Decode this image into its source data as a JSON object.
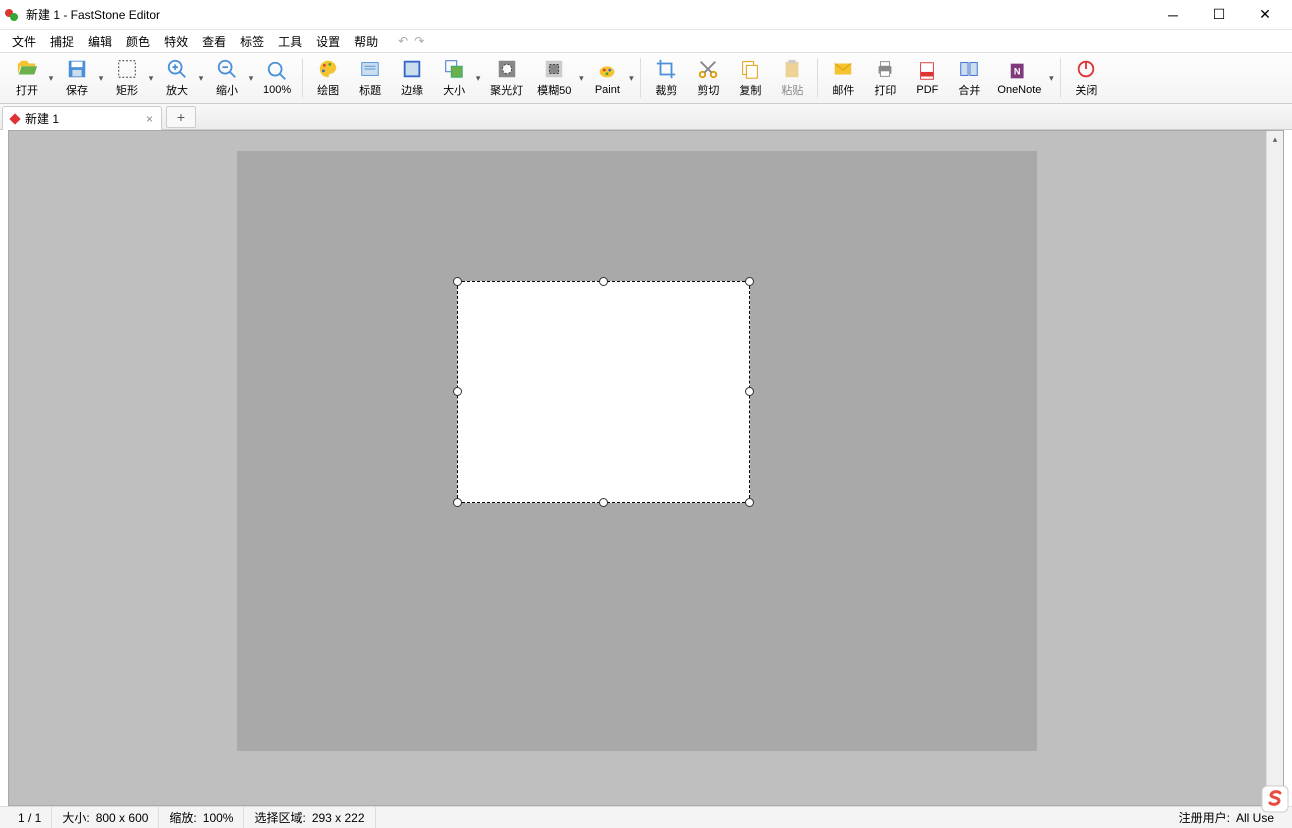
{
  "title": "新建 1 - FastStone Editor",
  "menu": [
    "文件",
    "捕捉",
    "编辑",
    "颜色",
    "特效",
    "查看",
    "标签",
    "工具",
    "设置",
    "帮助"
  ],
  "toolbar": {
    "open": "打开",
    "save": "保存",
    "rect": "矩形",
    "zoomin": "放大",
    "zoomout": "缩小",
    "zoom100": "100%",
    "draw": "绘图",
    "caption": "标题",
    "edge": "边缘",
    "size": "大小",
    "spotlight": "聚光灯",
    "blur": "模糊50",
    "paint": "Paint",
    "crop": "裁剪",
    "cut": "剪切",
    "copy": "复制",
    "paste": "粘贴",
    "mail": "邮件",
    "print": "打印",
    "pdf": "PDF",
    "merge": "合并",
    "onenote": "OneNote",
    "close": "关闭"
  },
  "tab": {
    "name": "新建 1"
  },
  "status": {
    "page": "1 / 1",
    "size_label": "大小:",
    "size_value": "800 x 600",
    "zoom_label": "缩放:",
    "zoom_value": "100%",
    "sel_label": "选择区域:",
    "sel_value": "293 x 222",
    "user_label": "注册用户:",
    "user_value": "All Use"
  }
}
